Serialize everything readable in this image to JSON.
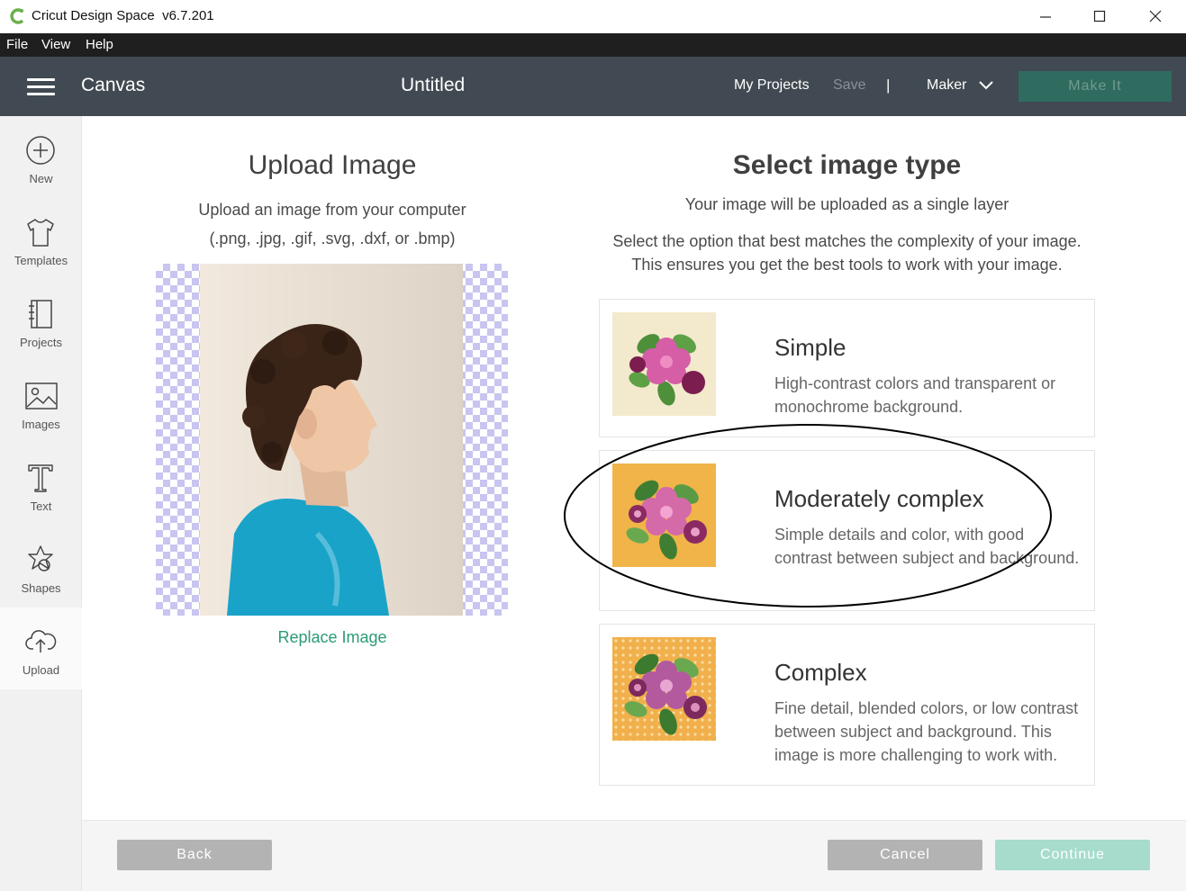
{
  "window": {
    "app_title": "Cricut Design Space",
    "version": "v6.7.201"
  },
  "menu": {
    "file": "File",
    "view": "View",
    "help": "Help"
  },
  "header": {
    "section": "Canvas",
    "project_title": "Untitled",
    "my_projects": "My Projects",
    "save": "Save",
    "separator": "|",
    "machine": "Maker",
    "make_it": "Make It"
  },
  "sidebar": {
    "items": [
      {
        "label": "New",
        "icon": "plus-circle-icon"
      },
      {
        "label": "Templates",
        "icon": "tshirt-icon"
      },
      {
        "label": "Projects",
        "icon": "notebook-icon"
      },
      {
        "label": "Images",
        "icon": "image-icon"
      },
      {
        "label": "Text",
        "icon": "text-icon"
      },
      {
        "label": "Shapes",
        "icon": "shapes-icon"
      },
      {
        "label": "Upload",
        "icon": "cloud-upload-icon",
        "active": true
      }
    ]
  },
  "upload": {
    "heading": "Upload Image",
    "line1": "Upload an image from your computer",
    "line2": "(.png, .jpg, .gif, .svg, .dxf, or .bmp)",
    "replace": "Replace Image"
  },
  "select": {
    "heading": "Select image type",
    "line1": "Your image will be uploaded as a single layer",
    "line2": "Select the option that best matches the complexity of your image.",
    "line3": "This ensures you get the best tools to work with your image.",
    "options": [
      {
        "title": "Simple",
        "desc": "High-contrast colors and transparent or monochrome background."
      },
      {
        "title": "Moderately complex",
        "desc": "Simple details and color, with good contrast between subject and background."
      },
      {
        "title": "Complex",
        "desc": "Fine detail, blended colors, or low contrast between subject and background. This image is more challenging to work with."
      }
    ]
  },
  "footer": {
    "back": "Back",
    "cancel": "Cancel",
    "continue": "Continue"
  },
  "colors": {
    "header_bg": "#414a52",
    "make_it_bg": "#306b60",
    "accent_green": "#2b9b76",
    "continue_bg": "#a7dccc"
  }
}
